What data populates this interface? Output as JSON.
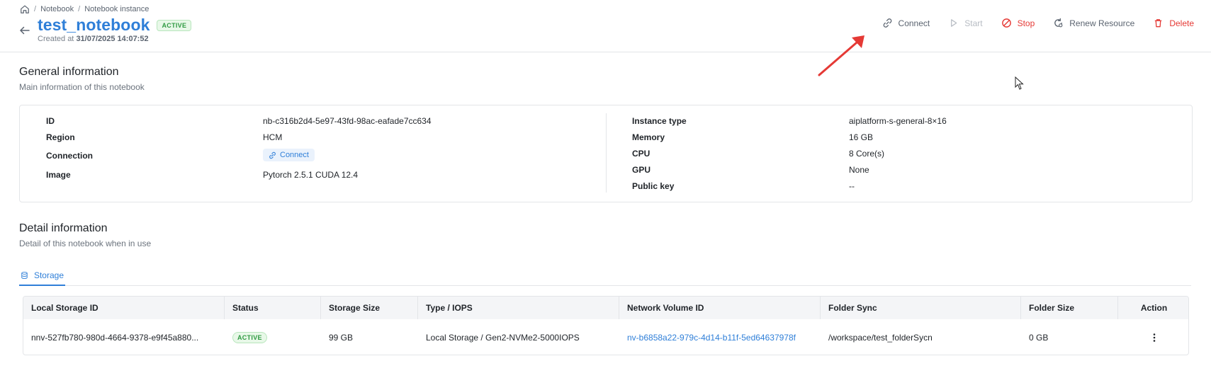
{
  "breadcrumb": {
    "items": [
      "Notebook",
      "Notebook instance"
    ]
  },
  "header": {
    "title": "test_notebook",
    "status": "ACTIVE",
    "created_label": "Created at",
    "created_value": "31/07/2025 14:07:52"
  },
  "actions": {
    "connect": "Connect",
    "start": "Start",
    "stop": "Stop",
    "renew": "Renew Resource",
    "delete": "Delete"
  },
  "general": {
    "title": "General information",
    "subtitle": "Main information of this notebook",
    "left": [
      {
        "label": "ID",
        "value": "nb-c316b2d4-5e97-43fd-98ac-eafade7cc634"
      },
      {
        "label": "Region",
        "value": "HCM"
      },
      {
        "label": "Connection",
        "value": "Connect"
      },
      {
        "label": "Image",
        "value": "Pytorch 2.5.1 CUDA 12.4"
      }
    ],
    "right": [
      {
        "label": "Instance type",
        "value": "aiplatform-s-general-8×16"
      },
      {
        "label": "Memory",
        "value": "16 GB"
      },
      {
        "label": "CPU",
        "value": "8 Core(s)"
      },
      {
        "label": "GPU",
        "value": "None"
      },
      {
        "label": "Public key",
        "value": "--"
      }
    ]
  },
  "detail": {
    "title": "Detail information",
    "subtitle": "Detail of this notebook when in use",
    "tab": "Storage"
  },
  "storage_table": {
    "columns": [
      "Local Storage ID",
      "Status",
      "Storage Size",
      "Type / IOPS",
      "Network Volume ID",
      "Folder Sync",
      "Folder Size",
      "Action"
    ],
    "rows": [
      {
        "local_storage_id": "nnv-527fb780-980d-4664-9378-e9f45a880...",
        "status": "ACTIVE",
        "storage_size": "99 GB",
        "type_iops": "Local Storage / Gen2-NVMe2-5000IOPS",
        "network_volume_id": "nv-b6858a22-979c-4d14-b11f-5ed64637978f",
        "folder_sync": "/workspace/test_folderSycn",
        "folder_size": "0 GB"
      }
    ]
  },
  "colors": {
    "accent": "#2f7fd8",
    "danger": "#e53935",
    "success": "#2f9a42"
  }
}
